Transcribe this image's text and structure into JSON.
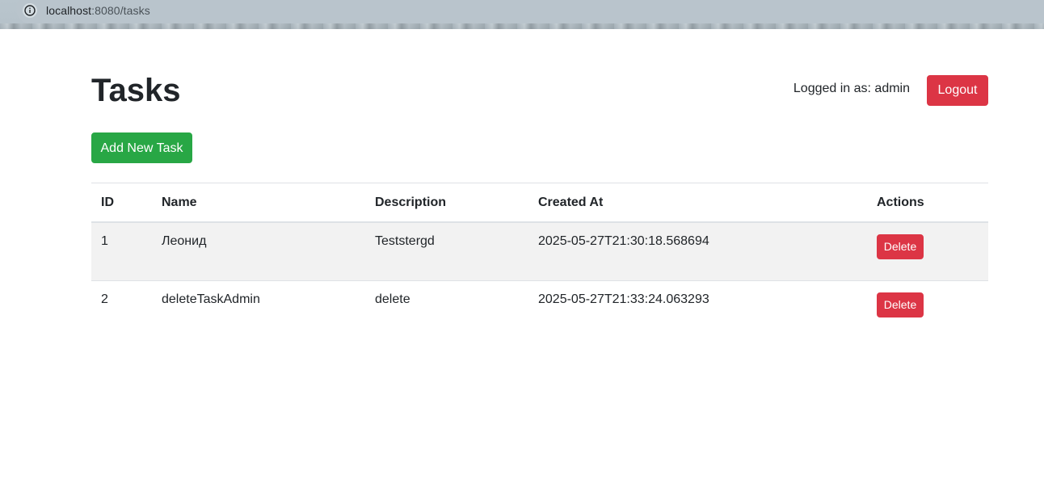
{
  "browser": {
    "url_host": "localhost",
    "url_path": ":8080/tasks"
  },
  "page": {
    "title": "Tasks"
  },
  "user": {
    "logged_in_label": "Logged in as: admin",
    "logout_label": "Logout"
  },
  "actions": {
    "add_label": "Add New Task"
  },
  "table": {
    "headers": {
      "id": "ID",
      "name": "Name",
      "description": "Description",
      "created_at": "Created At",
      "actions": "Actions"
    },
    "rows": [
      {
        "id": "1",
        "name": "Леонид",
        "description": "Teststergd",
        "created_at": "2025-05-27T21:30:18.568694",
        "delete_label": "Delete"
      },
      {
        "id": "2",
        "name": "deleteTaskAdmin",
        "description": "delete",
        "created_at": "2025-05-27T21:33:24.063293",
        "delete_label": "Delete"
      }
    ]
  },
  "colors": {
    "danger": "#dc3545",
    "success": "#28a745",
    "striped_row": "#f2f2f2"
  },
  "icons": {
    "address_bar": "info-icon"
  }
}
